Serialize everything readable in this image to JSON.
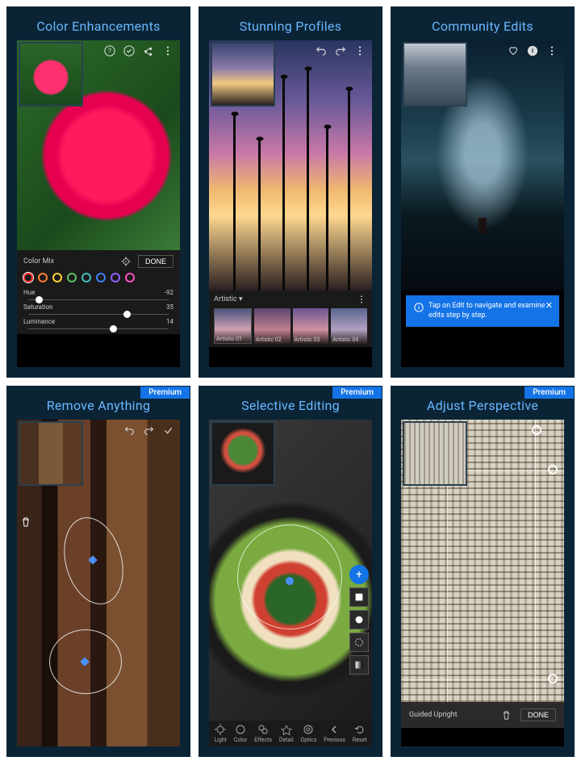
{
  "cards": [
    {
      "title": "Color Enhancements",
      "premium": false
    },
    {
      "title": "Stunning Profiles",
      "premium": false
    },
    {
      "title": "Community Edits",
      "premium": false
    },
    {
      "title": "Remove Anything",
      "premium": true
    },
    {
      "title": "Selective Editing",
      "premium": true
    },
    {
      "title": "Adjust Perspective",
      "premium": true
    }
  ],
  "premium_label": "Premium",
  "color_mix": {
    "panel_label": "Color Mix",
    "done_label": "DONE",
    "colors": [
      "#ff3030",
      "#ff8030",
      "#ffd030",
      "#60c060",
      "#40c0c0",
      "#4080ff",
      "#9060ff",
      "#ff50c0"
    ],
    "selected_index": 0,
    "sliders": [
      {
        "name": "Hue",
        "value": -92,
        "pos": 5
      },
      {
        "name": "Saturation",
        "value": 35,
        "pos": 68
      },
      {
        "name": "Luminance",
        "value": 14,
        "pos": 58
      }
    ]
  },
  "profiles": {
    "category": "Artistic",
    "items": [
      "Artistic 01",
      "Artistic 02",
      "Artistic 03",
      "Artistic 04"
    ]
  },
  "community_tip": "Tap on Edit to navigate and examine edits step by step.",
  "selective_tools": [
    "Light",
    "Color",
    "Effects",
    "Detail",
    "Optics",
    "Previous",
    "Reset"
  ],
  "perspective": {
    "mode": "Guided Upright",
    "done": "DONE"
  }
}
